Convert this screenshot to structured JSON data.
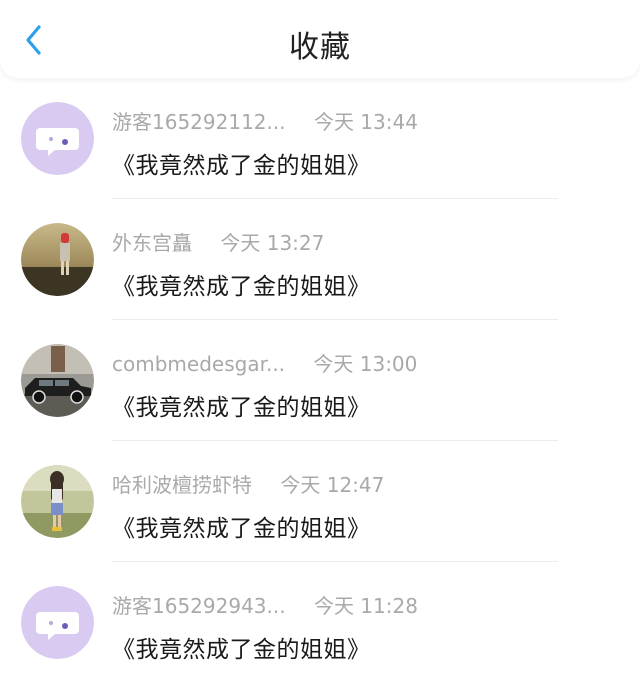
{
  "header": {
    "title": "收藏",
    "back_icon": "chevron-left-icon",
    "accent_color": "#2e9ef0"
  },
  "items": [
    {
      "username": "游客165292112...",
      "time": "今天 13:44",
      "content": "《我竟然成了金的姐姐》",
      "avatar": "default-chat-bubble-avatar"
    },
    {
      "username": "外东宫矗",
      "time": "今天 13:27",
      "content": "《我竟然成了金的姐姐》",
      "avatar": "photo-person-avatar"
    },
    {
      "username": "combmedesgar...",
      "time": "今天 13:00",
      "content": "《我竟然成了金的姐姐》",
      "avatar": "photo-vintage-car-avatar"
    },
    {
      "username": "哈利波檀捞虾特",
      "time": "今天 12:47",
      "content": "《我竟然成了金的姐姐》",
      "avatar": "photo-girl-outdoor-avatar"
    },
    {
      "username": "游客165292943...",
      "time": "今天 11:28",
      "content": "《我竟然成了金的姐姐》",
      "avatar": "default-chat-bubble-avatar"
    }
  ]
}
